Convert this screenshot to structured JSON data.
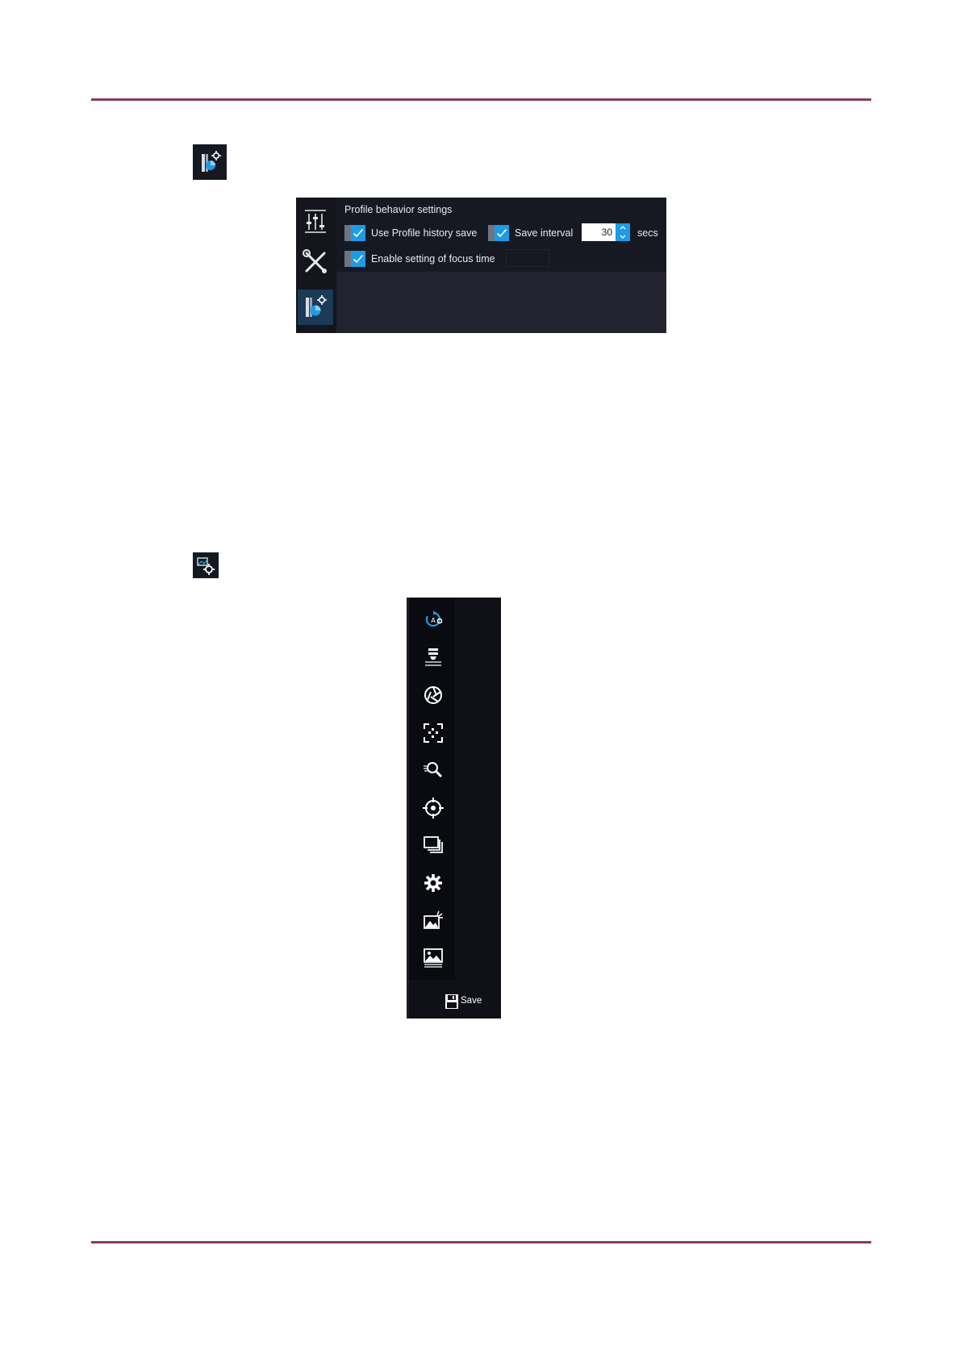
{
  "profile_panel": {
    "title": "Profile behavior settings",
    "use_history_label": "Use Profile history save",
    "use_history_checked": true,
    "save_interval_label": "Save interval",
    "save_interval_checked": true,
    "save_interval_value": "30",
    "save_interval_unit": "secs",
    "focus_time_label": "Enable setting of focus time",
    "focus_time_checked": true,
    "rail_icons": [
      "sliders-icon",
      "tools-icon",
      "profile-settings-icon"
    ],
    "active_rail_icon": "profile-settings-icon"
  },
  "toolbar": {
    "icons": [
      "auto-mode-icon",
      "light-source-icon",
      "aperture-icon",
      "autofocus-area-icon",
      "zoom-icon",
      "target-icon",
      "layers-icon",
      "gear-icon",
      "image-adjust-icon",
      "image-settings-icon"
    ],
    "save_label": "Save"
  },
  "colors": {
    "accent": "#1e9be6",
    "rule": "#8a3a5e",
    "panel_bg": "#171922",
    "toolbar_bg": "#090b10"
  }
}
